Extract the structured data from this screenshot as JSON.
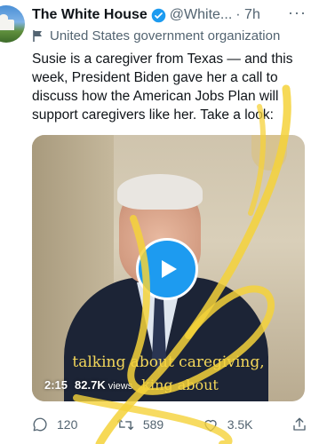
{
  "header": {
    "name": "The White House",
    "handle": "@White...",
    "time": "· 7h",
    "menu": "···"
  },
  "org_label": "United States government organization",
  "tweet_text": "Susie is a caregiver from Texas — and this week, President Biden gave her a call to discuss how the American Jobs Plan will support caregivers like her. Take a look:",
  "video": {
    "caption_line": "talking about caregiving,",
    "duration": "2:15",
    "views_count": "82.7K",
    "views_label": "views",
    "overlay_fragment": "king about"
  },
  "actions": {
    "replies": "120",
    "retweets": "589",
    "likes": "3.5K"
  },
  "colors": {
    "accent": "#1d9bf0",
    "scribble": "#f5d23a",
    "caption": "#f2d65a"
  }
}
